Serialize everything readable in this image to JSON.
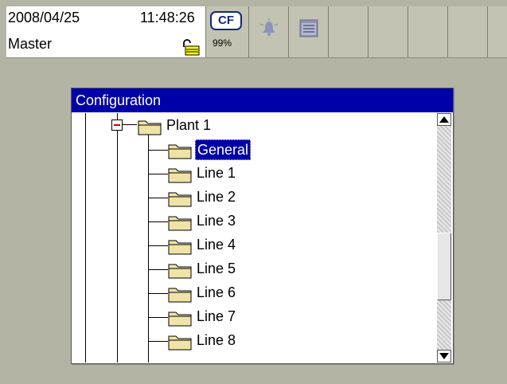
{
  "status": {
    "date": "2008/04/25",
    "time": "11:48:26",
    "user": "Master",
    "cf_label": "CF",
    "cf_percent": "99%"
  },
  "config": {
    "title": "Configuration",
    "root": "Plant 1",
    "items": [
      "General",
      "Line 1",
      "Line 2",
      "Line 3",
      "Line 4",
      "Line 5",
      "Line 6",
      "Line 7",
      "Line 8"
    ],
    "selected": "General"
  },
  "colors": {
    "title_bar": "#0000a8",
    "background": "#b4b4a4",
    "folder_fill": "#efe4a6"
  },
  "icons": [
    "lock-icon",
    "cf-card-icon",
    "alarm-bell-icon",
    "calendar-icon",
    "folder-icon",
    "scroll-up-icon",
    "scroll-down-icon"
  ]
}
